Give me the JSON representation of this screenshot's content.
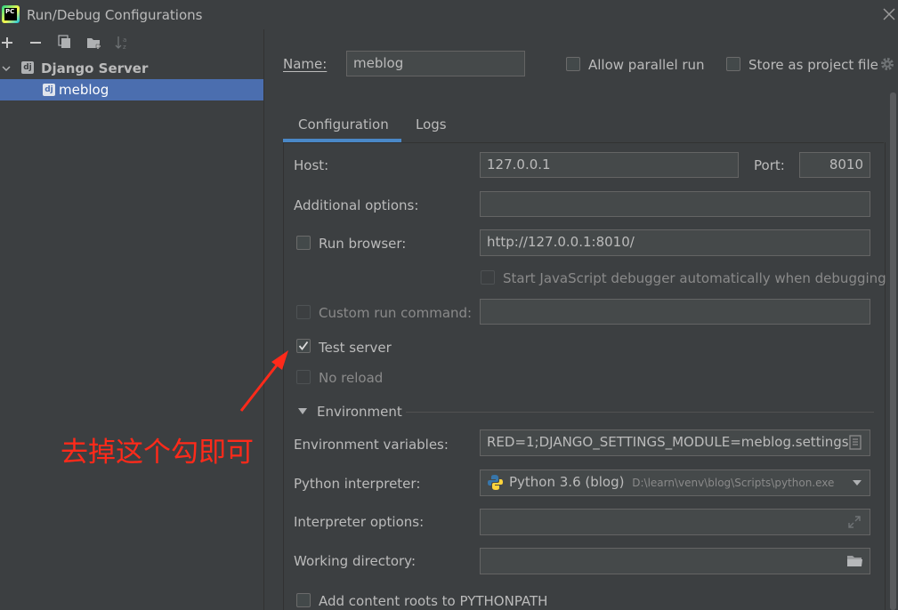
{
  "window": {
    "title": "Run/Debug Configurations",
    "app_badge": "PC"
  },
  "tree": {
    "group_icon": "dj",
    "group_label": "Django Server",
    "item_icon": "dj",
    "item_label": "meblog"
  },
  "name_row": {
    "label": "Name:",
    "value": "meblog",
    "allow_parallel_label": "Allow parallel run",
    "store_project_label": "Store as project file"
  },
  "tabs": {
    "config": "Configuration",
    "logs": "Logs"
  },
  "form": {
    "host_label": "Host:",
    "host_value": "127.0.0.1",
    "port_label": "Port:",
    "port_value": "8010",
    "additional_label": "Additional options:",
    "run_browser_label": "Run browser:",
    "run_browser_url": "http://127.0.0.1:8010/",
    "js_debugger_label": "Start JavaScript debugger automatically when debugging",
    "custom_cmd_label": "Custom run command:",
    "test_server_label": "Test server",
    "no_reload_label": "No reload",
    "environment_label": "Environment",
    "env_vars_label": "Environment variables:",
    "env_vars_value": "RED=1;DJANGO_SETTINGS_MODULE=meblog.settings",
    "interpreter_label": "Python interpreter:",
    "interpreter_name": "Python 3.6 (blog)",
    "interpreter_path": "D:\\learn\\venv\\blog\\Scripts\\python.exe",
    "interp_options_label": "Interpreter options:",
    "working_dir_label": "Working directory:",
    "content_roots_label": "Add content roots to PYTHONPATH"
  },
  "annotation": {
    "text": "去掉这个勾即可",
    "color": "#ff2a1a"
  },
  "colors": {
    "accent": "#4a88c7",
    "selection": "#4b6eaf",
    "bg": "#3c3f41"
  }
}
